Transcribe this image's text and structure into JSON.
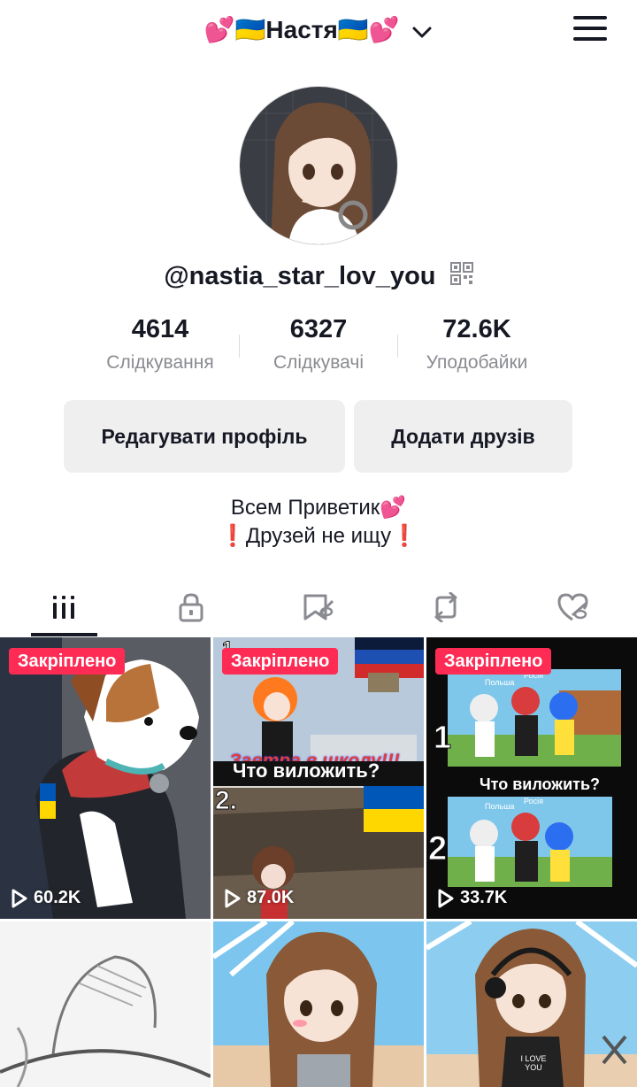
{
  "header": {
    "display_name": "💕🇺🇦Настя🇺🇦💕",
    "menu_icon": "hamburger-menu-icon"
  },
  "profile": {
    "username": "@nastia_star_lov_you"
  },
  "stats": [
    {
      "value": "4614",
      "label": "Слідкування"
    },
    {
      "value": "6327",
      "label": "Слідкувачі"
    },
    {
      "value": "72.6K",
      "label": "Уподобайки"
    }
  ],
  "actions": {
    "edit_profile": "Редагувати профіль",
    "add_friends": "Додати друзів"
  },
  "bio": {
    "line1": "Всем Приветик💕",
    "line2": "❗Друзей не ищу❗"
  },
  "tabs": [
    {
      "icon": "videos-grid-icon",
      "active": true
    },
    {
      "icon": "lock-icon",
      "active": false
    },
    {
      "icon": "saved-icon",
      "active": false
    },
    {
      "icon": "repost-icon",
      "active": false
    },
    {
      "icon": "liked-icon",
      "active": false
    }
  ],
  "videos": [
    {
      "pinned_label": "Закріплено",
      "views": "60.2K"
    },
    {
      "pinned_label": "Закріплено",
      "views": "87.0K",
      "overlay_text_1": "Завтра в школу!!!",
      "overlay_text_2": "Что виложить?",
      "marker_1": "1.",
      "marker_2": "2."
    },
    {
      "pinned_label": "Закріплено",
      "views": "33.7K",
      "overlay_text": "Что виложить?",
      "marker_1": "1",
      "marker_2": "2",
      "tag_1": "Польша",
      "tag_2": "Росія",
      "tag_3": "Польша",
      "tag_4": "Росія"
    },
    {},
    {},
    {
      "shirt_text": "I LOVE YOU"
    }
  ],
  "colors": {
    "accent": "#fe2c55",
    "text": "#161823",
    "muted": "#8a8b91",
    "button_bg": "#efeff0"
  }
}
